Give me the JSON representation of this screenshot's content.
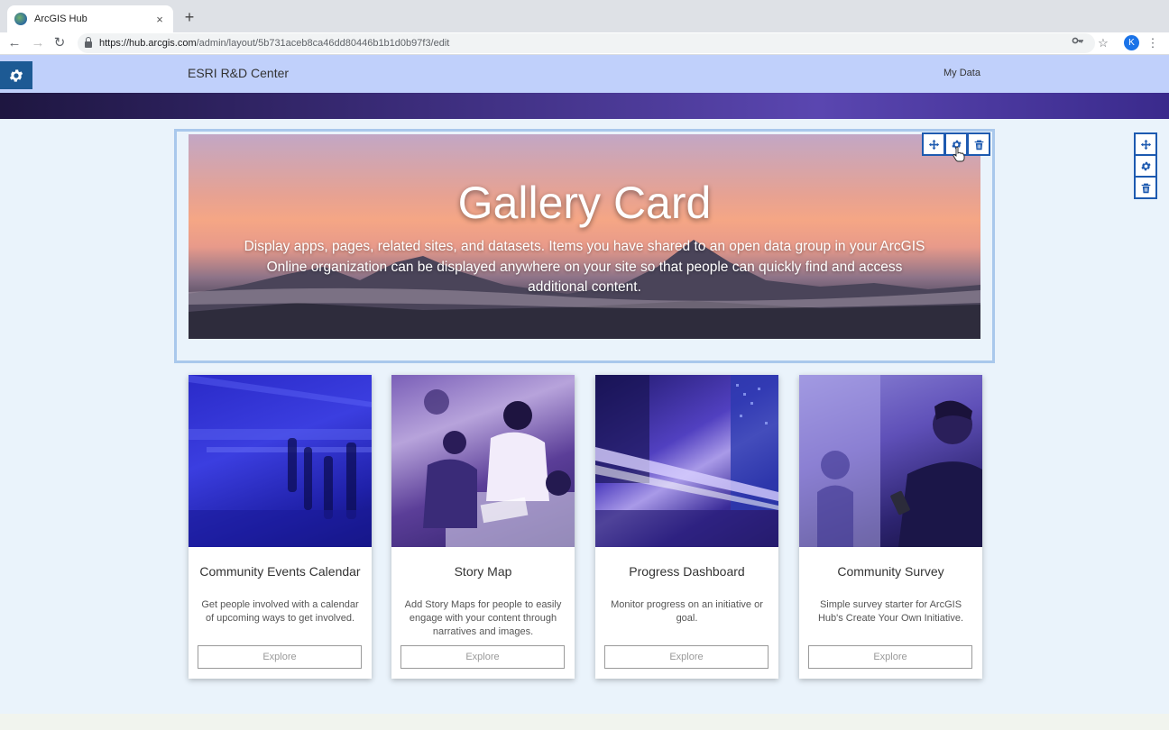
{
  "browser": {
    "tab_title": "ArcGIS Hub",
    "tab_close": "×",
    "new_tab": "+",
    "url_host": "https://hub.arcgis.com",
    "url_path": "/admin/layout/5b731aceb8ca46dd80446b1b1d0b97f3/edit",
    "profile_initial": "K"
  },
  "site": {
    "title": "ESRI R&D Center",
    "nav_link": "My Data"
  },
  "gallery_card": {
    "title": "Gallery Card",
    "description": "Display apps, pages, related sites, and datasets. Items you have shared to an open data group in your ArcGIS Online organization can be displayed anywhere on your site so that people can quickly find and access additional content."
  },
  "cards": [
    {
      "name": "Community Events Calendar",
      "description": "Get people involved with a calendar of upcoming ways to get involved.",
      "button": "Explore"
    },
    {
      "name": "Story Map",
      "description": "Add Story Maps for people to easily engage with your content through narratives and images.",
      "button": "Explore"
    },
    {
      "name": "Progress Dashboard",
      "description": "Monitor progress on an initiative or goal.",
      "button": "Explore"
    },
    {
      "name": "Community Survey",
      "description": "Simple survey starter for ArcGIS Hub's Create Your Own Initiative.",
      "button": "Explore"
    }
  ],
  "colors": {
    "accent": "#1d5ab0",
    "header_bg": "#c0d0fb",
    "page_bg": "#eaf3fb"
  }
}
